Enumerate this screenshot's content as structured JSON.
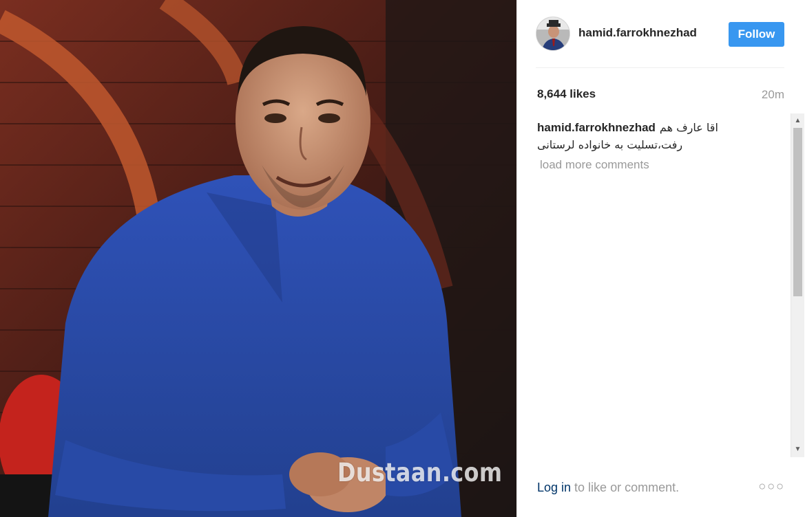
{
  "post": {
    "image_description": "",
    "watermark": "Dustaan.com"
  },
  "header": {
    "username": "hamid.farrokhnezhad",
    "follow_label": "Follow",
    "avatar_icon": "avatar-photo"
  },
  "stats": {
    "likes": "8,644 likes",
    "time_ago": "20m"
  },
  "caption": {
    "username": "hamid.farrokhnezhad",
    "text_line1": "اقا عارف هم",
    "text_line2": "رفت،تسلیت به خانواده لرستانی"
  },
  "comments": {
    "load_more": "load more comments"
  },
  "footer": {
    "login_link": "Log in",
    "login_rest": " to like or comment.",
    "more_icon": "ellipsis-icon"
  },
  "colors": {
    "accent": "#3897f0",
    "link": "#003569",
    "muted": "#999999",
    "text": "#262626"
  }
}
